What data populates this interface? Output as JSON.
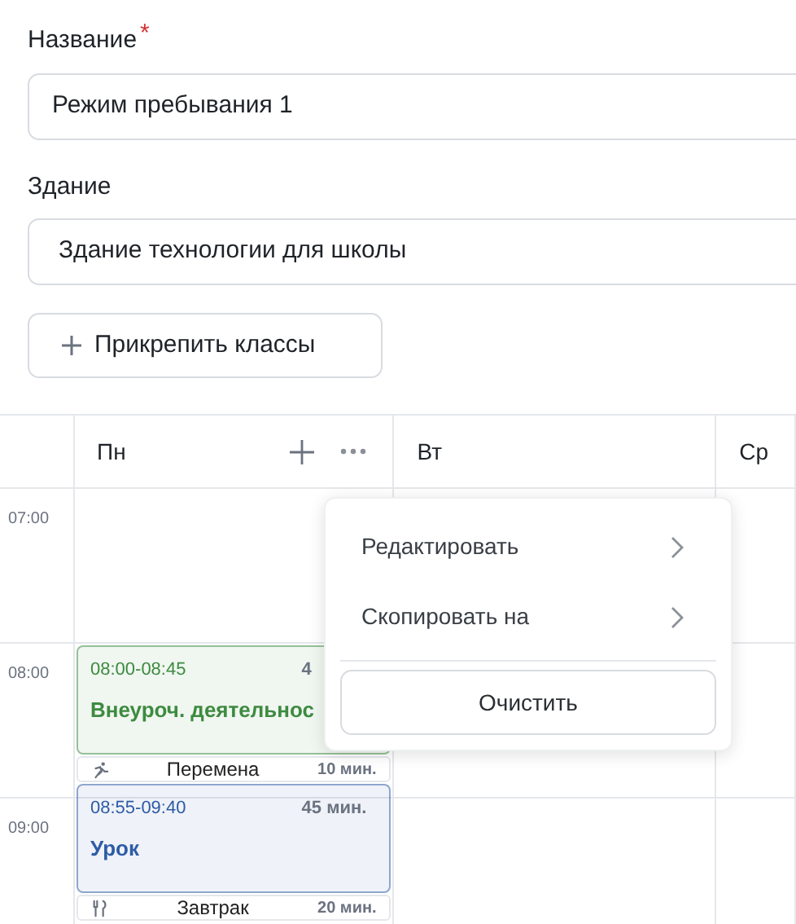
{
  "form": {
    "name_label": "Название",
    "required_mark": "*",
    "name_value": "Режим пребывания 1",
    "building_label": "Здание",
    "building_value": "Здание технологии для школы",
    "attach_button": "Прикрепить классы"
  },
  "schedule": {
    "days": [
      {
        "label": "Пн",
        "actions": true
      },
      {
        "label": "Вт"
      },
      {
        "label": "Ср"
      }
    ],
    "hours": [
      "07:00",
      "08:00",
      "09:00"
    ],
    "events": [
      {
        "kind": "lesson",
        "time": "08:00-08:45",
        "duration": "4",
        "title": "Внеуроч. деятельнос",
        "color": "#3d8b40"
      },
      {
        "kind": "recess",
        "title": "Перемена",
        "duration": "10 мин."
      },
      {
        "kind": "lesson",
        "time": "08:55-09:40",
        "duration": "45 мин.",
        "title": "Урок",
        "color": "#2e5ca6"
      },
      {
        "kind": "meal",
        "title": "Завтрак",
        "duration": "20 мин."
      }
    ]
  },
  "menu": {
    "items": [
      {
        "label": "Редактировать"
      },
      {
        "label": "Скопировать на"
      }
    ],
    "button": "Очистить"
  }
}
